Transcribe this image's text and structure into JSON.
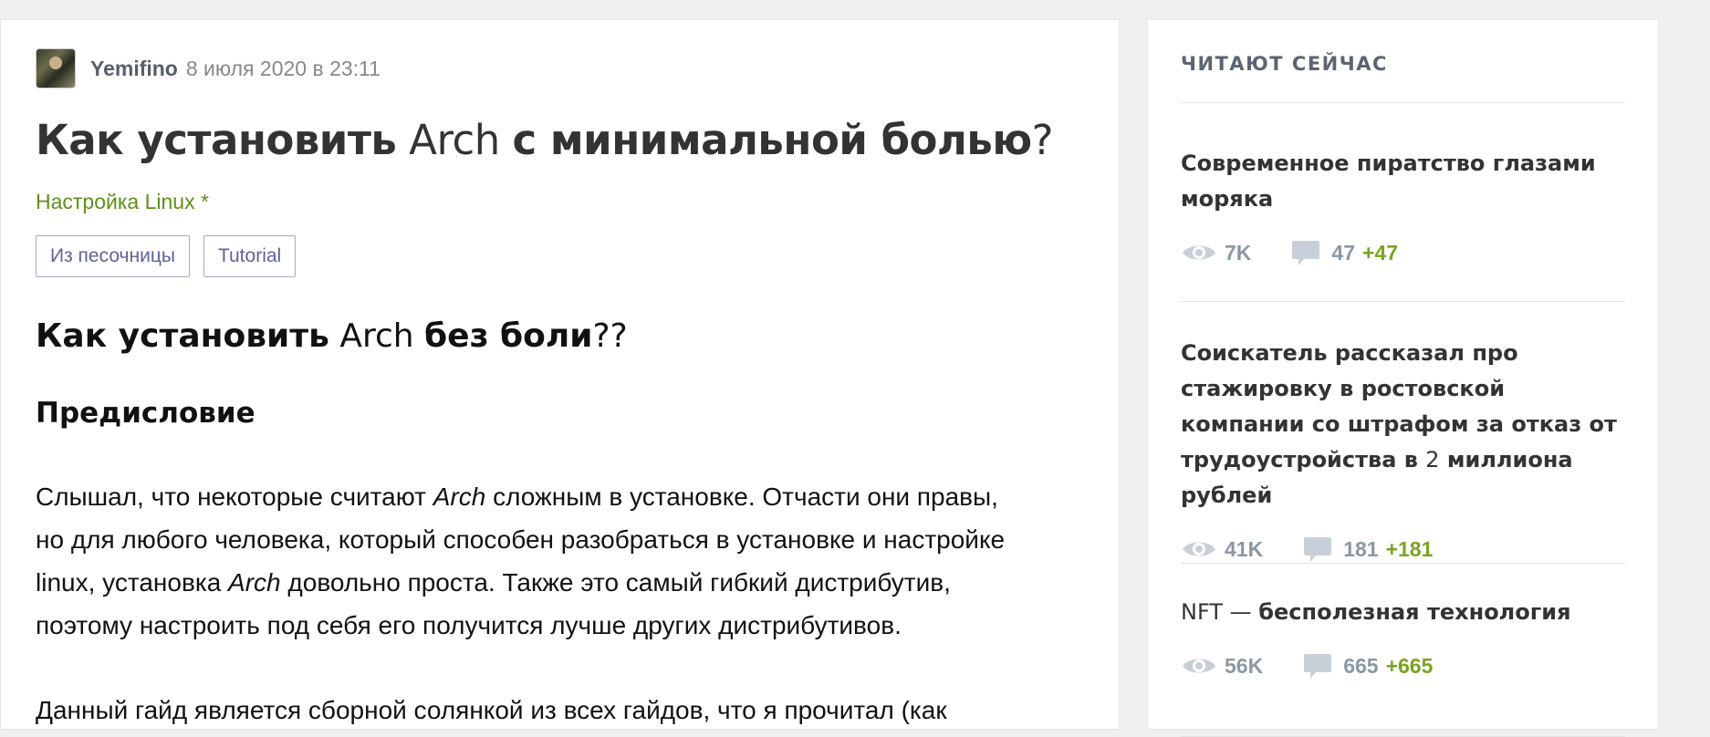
{
  "article": {
    "author": "Yemifino",
    "date": "8 июля 2020 в 23:11",
    "title_part1": "Как установить",
    "title_part2": " Arch ",
    "title_part3": "с минимальной болью",
    "title_part4": "?",
    "hub": "Настройка Linux *",
    "tags": [
      "Из песочницы",
      "Tutorial"
    ],
    "heading_part1": "Как установить",
    "heading_part2": " Arch ",
    "heading_part3": "без боли",
    "heading_part4": "??",
    "subheading": "Предисловие",
    "p1_a": "Слышал, что некоторые считают ",
    "p1_b": "Arch",
    "p1_c": " сложным в установке. Отчасти они правы,",
    "p1_d": "но для любого человека, который способен разобраться в установке и настройке",
    "p1_e": "linux, установка ",
    "p1_f": "Arch",
    "p1_g": " довольно проста. Также это самый гибкий дистрибутив,",
    "p1_h": "поэтому настроить под себя его получится лучше других дистрибутивов.",
    "p2": "Данный гайд является сборной солянкой из всех гайдов, что я прочитал (как"
  },
  "sidebar": {
    "heading": "ЧИТАЮТ СЕЙЧАС",
    "posts": [
      {
        "title_a": "Современное пиратство глазами моряка",
        "title_b": "",
        "title_c": "",
        "views": "7K",
        "comments": "47",
        "new_comments": "+47"
      },
      {
        "title_a": "Соискатель рассказал про стажировку в ростовской компании со штрафом за отказ от трудоустройства в ",
        "title_b": "2",
        "title_c": " миллиона рублей",
        "views": "41K",
        "comments": "181",
        "new_comments": "+181"
      },
      {
        "title_a": "",
        "title_b": "NFT — ",
        "title_c": "бесполезная технология",
        "views": "56K",
        "comments": "665",
        "new_comments": "+665"
      }
    ]
  },
  "colors": {
    "hub_green": "#5e8f16",
    "new_comments_green": "#7aa420",
    "tag_border": "#a7a9c8",
    "tag_text": "#5c6399",
    "stats_grey": "#8a98a5"
  },
  "icons": [
    "avatar",
    "eye-icon",
    "comment-bubble-icon"
  ]
}
